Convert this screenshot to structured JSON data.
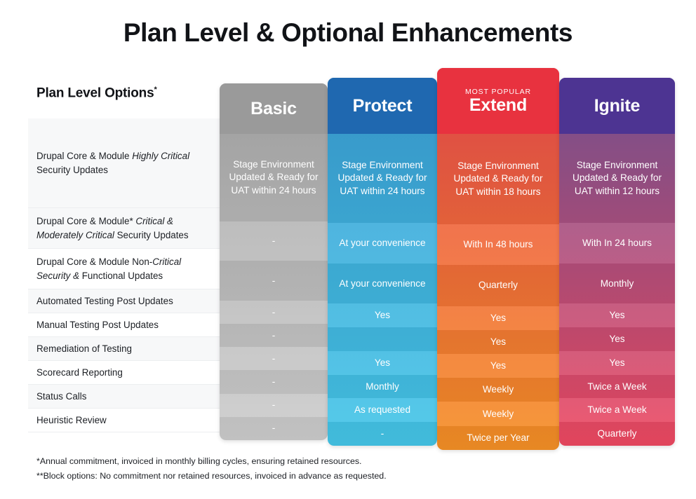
{
  "page": {
    "title": "Plan Level & Optional Enhancements"
  },
  "table": {
    "row_header_label": "Plan Level Options",
    "row_header_marker": "*",
    "most_popular_badge": "MOST POPULAR",
    "columns": [
      {
        "name": "Basic",
        "accent": "#9a9a9a",
        "popular": false
      },
      {
        "name": "Protect",
        "accent": "#1f68b0",
        "popular": false
      },
      {
        "name": "Extend",
        "accent": "#e8323f",
        "popular": true
      },
      {
        "name": "Ignite",
        "accent": "#4d3492",
        "popular": false
      }
    ],
    "rows": [
      {
        "label_html": "Drupal Core &amp; Module <em>Highly Critical</em> Security Updates",
        "values": [
          "Stage Environment Updated & Ready for UAT within 24 hours",
          "Stage Environment Updated & Ready for UAT within 24 hours",
          "Stage Environment Updated & Ready for UAT within 18 hours",
          "Stage Environment Updated & Ready for UAT within 12 hours"
        ]
      },
      {
        "label_html": "Drupal Core &amp; Module* <em>Critical &amp; Moderately Critical</em> Security Updates",
        "values": [
          "-",
          "At your convenience",
          "With In 48 hours",
          "With In 24 hours"
        ]
      },
      {
        "label_html": "Drupal Core &amp; Module Non-<em>Critical Security &amp;</em>  Functional Updates",
        "values": [
          "-",
          "At your convenience",
          "Quarterly",
          "Monthly"
        ]
      },
      {
        "label_html": "Automated Testing Post Updates",
        "values": [
          "-",
          "Yes",
          "Yes",
          "Yes"
        ]
      },
      {
        "label_html": "Manual Testing Post Updates",
        "values": [
          "-",
          "",
          "Yes",
          "Yes"
        ]
      },
      {
        "label_html": "Remediation of Testing",
        "values": [
          "-",
          "Yes",
          "Yes",
          "Yes"
        ]
      },
      {
        "label_html": "Scorecard Reporting",
        "values": [
          "-",
          "Monthly",
          "Weekly",
          "Twice a Week"
        ]
      },
      {
        "label_html": "Status Calls",
        "values": [
          "-",
          "As requested",
          "Weekly",
          "Twice a Week"
        ]
      },
      {
        "label_html": "Heuristic Review",
        "values": [
          "-",
          "-",
          "Twice per Year",
          "Quarterly"
        ]
      }
    ]
  },
  "footnotes": [
    "*Annual commitment, invoiced in monthly billing cycles, ensuring retained resources.",
    "**Block options: No commitment nor retained resources, invoiced in advance as requested."
  ]
}
